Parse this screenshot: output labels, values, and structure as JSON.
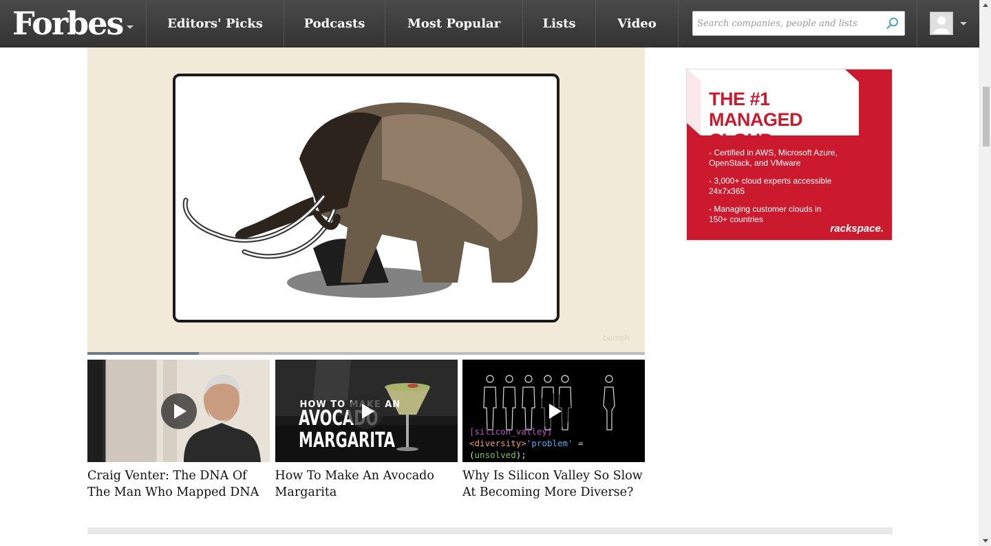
{
  "nav": {
    "logo": "Forbes",
    "items": [
      {
        "label": "Editors' Picks"
      },
      {
        "label": "Podcasts"
      },
      {
        "label": "Most Popular"
      },
      {
        "label": "Lists"
      },
      {
        "label": "Video"
      }
    ],
    "search_placeholder": "Search companies, people and lists",
    "icons": {
      "search": "search-icon",
      "avatar": "user-avatar-icon"
    }
  },
  "video": {
    "progress": 0.2,
    "watermark": "bumph"
  },
  "thumbnails": [
    {
      "title": "Craig Venter: The DNA Of The Man Who Mapped DNA"
    },
    {
      "title": "How To Make An Avocado Margarita",
      "overlay_small": "HOW TO MAKE AN",
      "overlay_big": "AVOCADO MARGARITA"
    },
    {
      "title": "Why Is Silicon Valley So Slow At Becoming More Diverse?",
      "code_line1": "[silicon_valley]",
      "code_line2_a": "<diversity>",
      "code_line2_b": "'problem'",
      "code_line2_c": " = (",
      "code_line2_d": "unsolved",
      "code_line2_e": ");"
    }
  ],
  "ad": {
    "headline_1": "THE #1 MANAGED",
    "headline_2": "CLOUD COMPANY",
    "bullets": [
      "- Certified in AWS, Microsoft Azure, OpenStack, and VMware",
      "- 3,000+ cloud experts accessible 24x7x365",
      "- Managing customer clouds in 150+ countries"
    ],
    "brand": "rackspace.",
    "color": "#cb1a2e"
  }
}
